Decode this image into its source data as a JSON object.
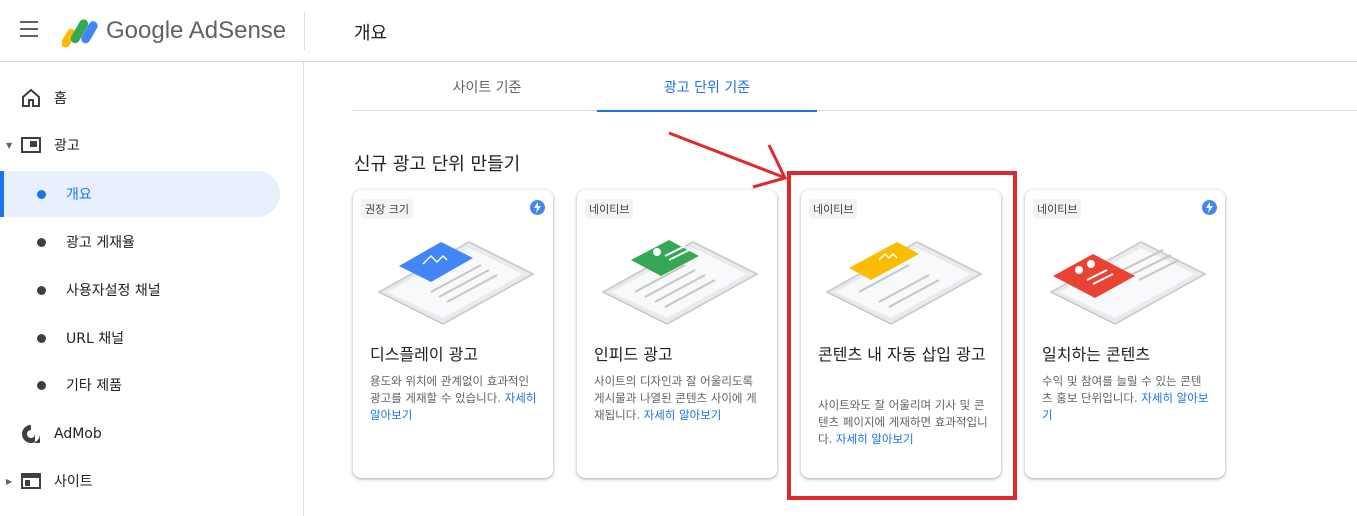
{
  "header": {
    "brand": "Google AdSense",
    "page_title": "개요"
  },
  "sidebar": {
    "items": [
      {
        "label": "홈"
      },
      {
        "label": "광고"
      },
      {
        "label": "개요"
      },
      {
        "label": "광고 게재율"
      },
      {
        "label": "사용자설정 채널"
      },
      {
        "label": "URL 채널"
      },
      {
        "label": "기타 제품"
      },
      {
        "label": "AdMob"
      },
      {
        "label": "사이트"
      }
    ]
  },
  "tabs": [
    {
      "label": "사이트 기준"
    },
    {
      "label": "광고 단위 기준"
    }
  ],
  "section_title": "신규 광고 단위 만들기",
  "cards": [
    {
      "badge": "권장 크기",
      "title": "디스플레이 광고",
      "desc": "용도와 위치에 관계없이 효과적인 광고를 게재할 수 있습니다.",
      "link": "자세히 알아보기",
      "color": "#4285f4"
    },
    {
      "badge": "네이티브",
      "title": "인피드 광고",
      "desc": "사이트의 디자인과 잘 어울리도록 게시물과 나열된 콘텐츠 사이에 게재됩니다.",
      "link": "자세히 알아보기",
      "color": "#34a853"
    },
    {
      "badge": "네이티브",
      "title": "콘텐츠 내 자동 삽입 광고",
      "desc": "사이트와도 잘 어울리며 기사 및 콘텐츠 페이지에 게재하면 효과적입니다.",
      "link": "자세히 알아보기",
      "color": "#fbbc04"
    },
    {
      "badge": "네이티브",
      "title": "일치하는 콘텐츠",
      "desc": "수익 및 참여를 늘릴 수 있는 콘텐츠 홍보 단위입니다.",
      "link": "자세히 알아보기",
      "color": "#ea4335"
    }
  ],
  "colors": {
    "accent": "#1a73e8",
    "highlight_frame": "#e0282d"
  }
}
